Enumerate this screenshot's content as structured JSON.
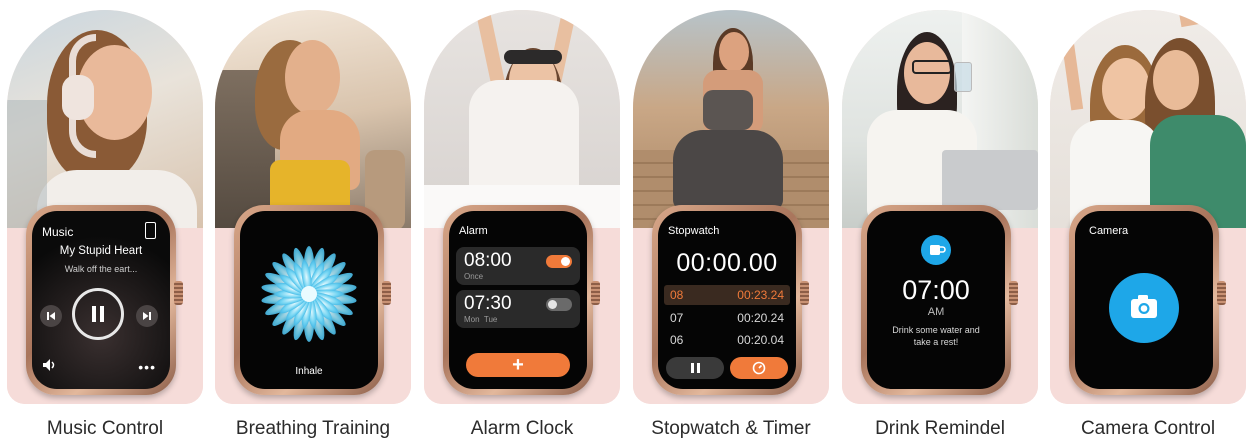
{
  "captions": [
    "Music Control",
    "Breathing Training",
    "Alarm Clock",
    "Stopwatch & Timer",
    "Drink Remindel",
    "Camera Control"
  ],
  "music": {
    "title": "Music",
    "song": "My Stupid Heart",
    "artist": "Walk off the eart...",
    "icons": [
      "phone-icon",
      "prev-icon",
      "pause-icon",
      "next-icon",
      "volume-icon",
      "more-icon"
    ]
  },
  "breathing": {
    "label": "Inhale",
    "icon": "flower-icon"
  },
  "alarm": {
    "title": "Alarm",
    "items": [
      {
        "time": "08:00",
        "sub": "Once",
        "on": true
      },
      {
        "time": "07:30",
        "sub": "Mon  Tue",
        "on": false
      }
    ],
    "add_label": "+"
  },
  "stopwatch": {
    "title": "Stopwatch",
    "time": "00:00.00",
    "laps": [
      {
        "num": "08",
        "time": "00:23.24",
        "active": true
      },
      {
        "num": "07",
        "time": "00:20.24",
        "active": false
      },
      {
        "num": "06",
        "time": "00:20.04",
        "active": false
      }
    ]
  },
  "drink": {
    "time": "07:00",
    "ampm": "AM",
    "message_1": "Drink some water and",
    "message_2": "take a rest!",
    "icon": "cup-icon"
  },
  "camera": {
    "title": "Camera",
    "icon": "camera-icon"
  },
  "colors": {
    "accent_orange": "#f07a3a",
    "accent_blue": "#1ea7e8",
    "pink_bg": "#f6dcd9"
  }
}
